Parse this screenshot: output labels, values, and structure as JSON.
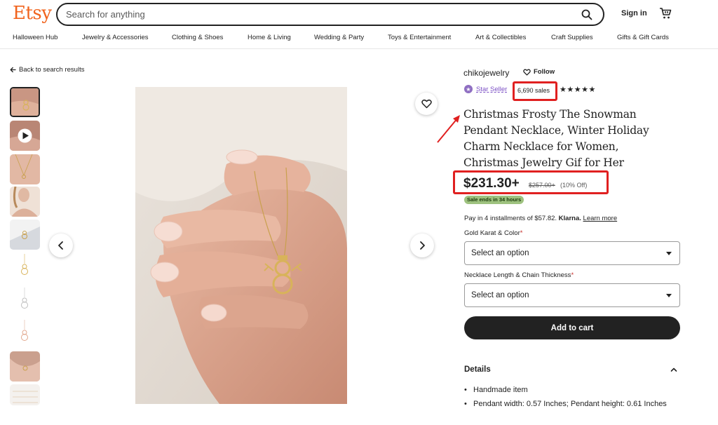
{
  "header": {
    "logo": "Etsy",
    "search_placeholder": "Search for anything",
    "signin_label": "Sign in"
  },
  "nav": [
    "Halloween Hub",
    "Jewelry & Accessories",
    "Clothing & Shoes",
    "Home & Living",
    "Wedding & Party",
    "Toys & Entertainment",
    "Art & Collectibles",
    "Craft Supplies",
    "Gifts & Gift Cards"
  ],
  "gallery": {
    "back_label": "Back to search results",
    "thumbnail_count": 10,
    "selected_thumbnail": 0
  },
  "listing": {
    "shop_name": "chikojewelry",
    "follow_label": "Follow",
    "star_seller_label": "Star Seller",
    "sales": "6,690 sales",
    "stars": "★★★★★",
    "rating": 5,
    "title": "Christmas Frosty The Snowman Pendant Necklace, Winter Holiday Charm Necklace for Women, Christmas Jewelry Gif for Her",
    "price": "$231.30+",
    "original_price": "$257.00+",
    "discount": "(10% Off)",
    "sale_badge": "Sale ends in 34 hours",
    "installments_text": "Pay in 4 installments of $57.82.",
    "klarna": "Klarna.",
    "learn_more": "Learn more"
  },
  "options": {
    "karat_label": "Gold Karat & Color",
    "karat_value": "Select an option",
    "length_label": "Necklace Length & Chain Thickness",
    "length_value": "Select an option",
    "required_mark": "*"
  },
  "add_to_cart_label": "Add to cart",
  "details": {
    "heading": "Details",
    "items": [
      "Handmade item",
      "Pendant width: 0.57 Inches; Pendant height: 0.61 Inches"
    ]
  },
  "colors": {
    "brand": "#f1641e",
    "annotation_red": "#e02020",
    "sale_green": "#9ec27f",
    "star_seller_purple": "#7b4fc4"
  }
}
